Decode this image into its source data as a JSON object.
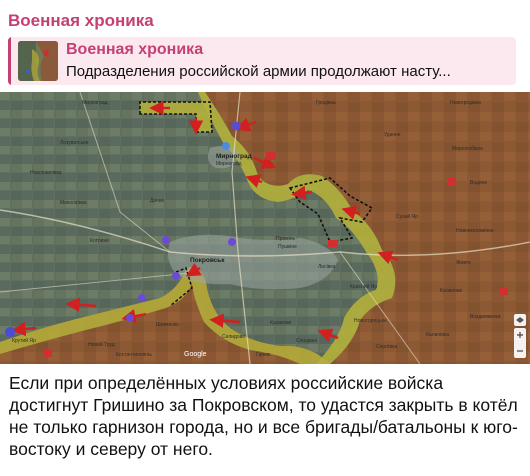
{
  "channel": {
    "name": "Военная хроника"
  },
  "reply": {
    "title": "Военная хроника",
    "text": "Подразделения российской армии продолжают насту..."
  },
  "map": {
    "labels": {
      "tl": "Мирноград",
      "pokrovsk": "Покровськ",
      "myrnohrad_label": "Мирноград",
      "myrnohrad_sub": "Мирноград",
      "promin": "Промінь",
      "pushkino": "Пушкіне",
      "novopavlivka": "Новопавлівка",
      "mykolaivka": "Миколаївка",
      "kotlyne": "Котлине",
      "hrodivka": "Гродівка",
      "udachne": "Удачне",
      "novohrodivka": "Новогродівка",
      "myrolubivka": "Миролюбівка",
      "sukhyi_yar": "Сухий Яр",
      "novoekonomichne": "Новоекономічне",
      "zhovte": "Жовте",
      "krasnyi_yar": "Красний Яр",
      "lysivka": "Лисівка",
      "novotoretske": "Новоторецьке",
      "serhiivka": "Сергіївка",
      "kalynove": "Калинове",
      "vozdvyzhenka": "Воздвиженка",
      "kalynivka": "Калинівка",
      "shevchenko": "Шевченко",
      "novyi_trud": "Новий Труд",
      "selidove": "Селидове",
      "kurakhove": "Кураховe",
      "krutyi_yar": "Крутий Яр",
      "kostiantynopil": "Костянтинопіль",
      "vodianyi": "Водяне",
      "lozuvatske": "Лозуватське",
      "sontsivka": "Сонцівка",
      "hirnyk": "Гірник",
      "dachenske": "Дачне",
      "google": "Google"
    }
  },
  "caption": {
    "text": "Если при определённых условиях российские войска достигнут Гришино за Покровском, то удастся закрыть в котёл не только гарнизон города, но и все бригады/батальоны к юго-востоку и северу от него."
  },
  "colors": {
    "accent": "#c63f74",
    "reply_bg": "#fbe9ef",
    "russian_zone": "#8b5a35",
    "contested_zone": "#b3b13a",
    "arrow": "#d21f1f"
  },
  "icons": {
    "map_layers": "layers-icon",
    "zoom": "zoom-controls-icon"
  }
}
